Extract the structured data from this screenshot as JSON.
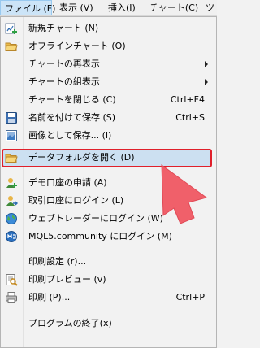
{
  "menubar": {
    "file": "ファイル (F)",
    "view": "表示 (V)",
    "insert": "挿入(I)",
    "chart": "チャート(C)",
    "more": "ツ"
  },
  "menu": {
    "new_chart": "新規チャート (N)",
    "offline_chart": "オフラインチャート (O)",
    "chart_reopen": "チャートの再表示",
    "chart_set": "チャートの組表示",
    "close_chart": "チャートを閉じる (C)",
    "close_chart_sc": "Ctrl+F4",
    "save_as": "名前を付けて保存 (S)",
    "save_as_sc": "Ctrl+S",
    "save_image": "画像として保存... (i)",
    "open_data_folder": "データフォルダを開く (D)",
    "demo_account": "デモ口座の申請 (A)",
    "login_trade": "取引口座にログイン (L)",
    "login_web": "ウェブトレーダーにログイン (W)",
    "login_mql5": "MQL5.community にログイン (M)",
    "print_setup": "印刷設定 (r)...",
    "print_preview": "印刷プレビュー (v)",
    "print": "印刷 (P)...",
    "print_sc": "Ctrl+P",
    "exit": "プログラムの終了(x)"
  },
  "colors": {
    "highlight_border": "#e0202b",
    "highlight_fill": "#cce0f1",
    "pointer": "#f0606a"
  }
}
